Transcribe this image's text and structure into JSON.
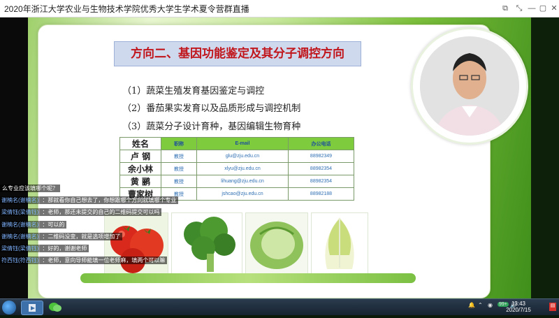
{
  "window": {
    "title": "2020年浙江大学农业与生物技术学院优秀大学生学术夏令营群直播",
    "controls": [
      "⧉",
      "⤡",
      "—",
      "▢",
      "✕"
    ]
  },
  "slide": {
    "title": "方向二、基因功能鉴定及其分子调控方向",
    "bullets": [
      "（1）蔬菜生殖发育基因鉴定与调控",
      "（2）番茄果实发育以及品质形成与调控机制",
      "（3）蔬菜分子设计育种，基因编辑生物育种"
    ],
    "table": {
      "headers": [
        "姓名",
        "职称",
        "E-mail",
        "办公电话"
      ],
      "rows": [
        [
          "卢  钢",
          "教授",
          "glu@zju.edu.cn",
          "88982349"
        ],
        [
          "余小林",
          "教授",
          "xlyu@zju.edu.cn",
          "88982354"
        ],
        [
          "黄  鹂",
          "教授",
          "lihuang@zju.edu.cn",
          "88982354"
        ],
        [
          "曹家树",
          "教授",
          "jshcao@zju.edu.cn",
          "88982188"
        ]
      ]
    },
    "images": [
      "tomato-photo",
      "broccoli-photo",
      "cabbage-photo",
      "chinese-cabbage-photo"
    ]
  },
  "chat": {
    "messages": [
      {
        "name": "",
        "text": "么专业应该填哪个呢？"
      },
      {
        "name": "谢楠名(谢楠名)",
        "text": "：那就看你自己想去了，你想跟哪个方向就填哪个专业"
      },
      {
        "name": "梁倩钰(梁倩钰)",
        "text": "：老师，那还未提交的自己的二维码提交可以吗"
      },
      {
        "name": "谢楠名(谢楠名)",
        "text": "：可以的"
      },
      {
        "name": "谢楠名(谢楠名)",
        "text": "：二维码没变，就是选项增加了"
      },
      {
        "name": "梁倩钰(梁倩钰)",
        "text": "：好的，谢谢老师"
      },
      {
        "name": "符西钰(符西钰)",
        "text": "：老师，意向导师能填一位老师麻，填两个可以嘛"
      }
    ]
  },
  "taskbar": {
    "time": "13:43",
    "date": "2020/7/15",
    "tray_badge": "99+"
  },
  "colors": {
    "slide_title": "#c0161c",
    "table_header": "#7ecb3e",
    "chat_name": "#7fb3ff"
  }
}
